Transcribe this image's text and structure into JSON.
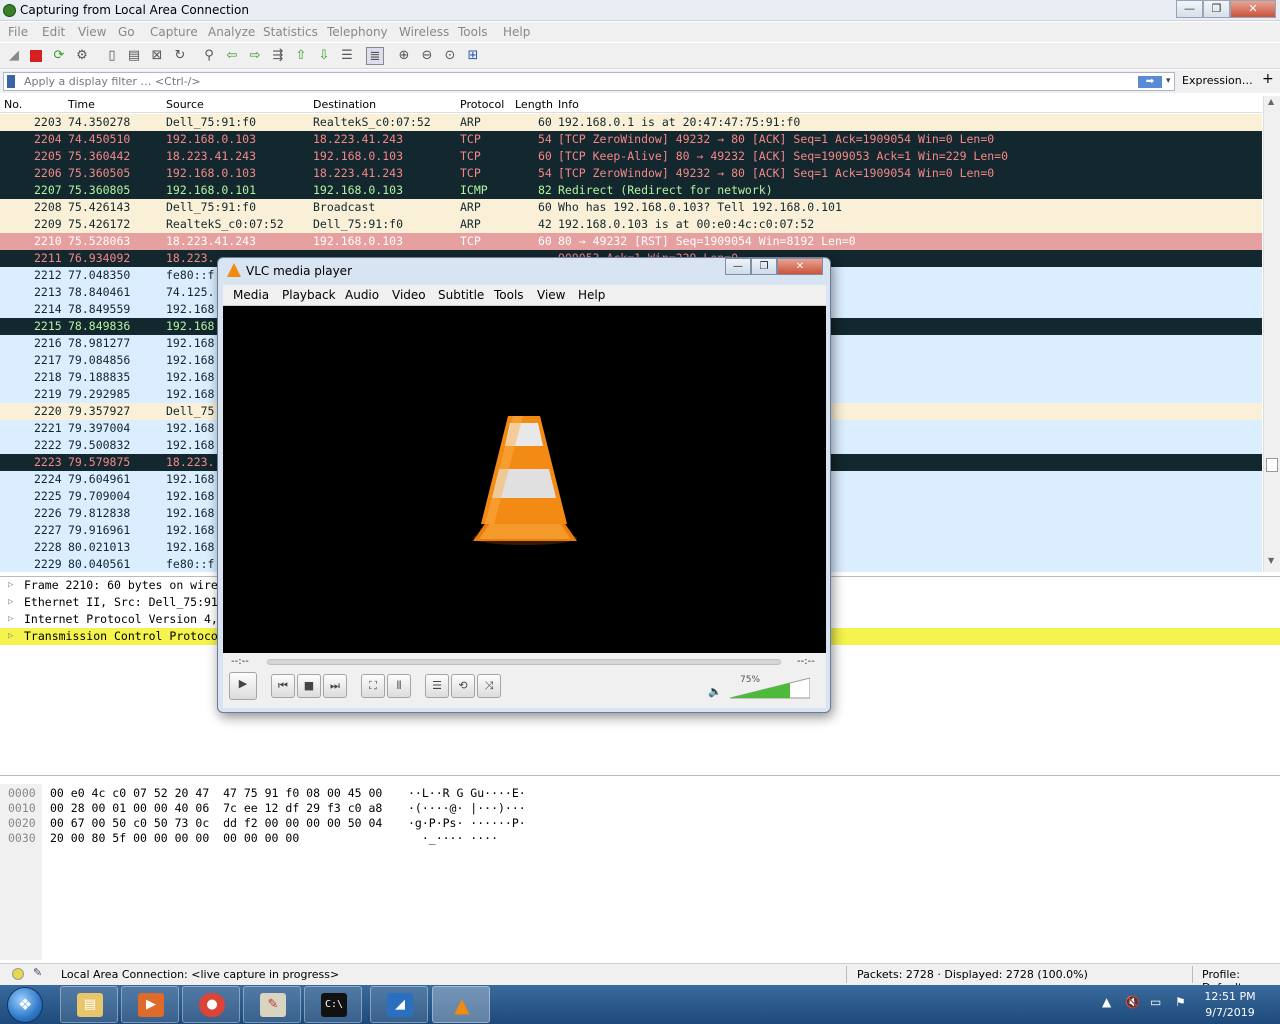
{
  "window": {
    "title": "Capturing from Local Area Connection",
    "min": "—",
    "max": "❐",
    "close": "✕"
  },
  "menu": [
    "File",
    "Edit",
    "View",
    "Go",
    "Capture",
    "Analyze",
    "Statistics",
    "Telephony",
    "Wireless",
    "Tools",
    "Help"
  ],
  "filter": {
    "placeholder": "Apply a display filter … <Ctrl-/>",
    "apply": "➡",
    "dropdown": "▾",
    "expression": "Expression…",
    "plus": "+"
  },
  "columns": {
    "no": "No.",
    "time": "Time",
    "source": "Source",
    "destination": "Destination",
    "protocol": "Protocol",
    "length": "Length",
    "info": "Info"
  },
  "packets": [
    {
      "no": "2203",
      "time": "74.350278",
      "src": "Dell_75:91:f0",
      "dst": "RealtekS_c0:07:52",
      "proto": "ARP",
      "len": "60",
      "info": "192.168.0.1 is at 20:47:47:75:91:f0",
      "style": "arp"
    },
    {
      "no": "2204",
      "time": "74.450510",
      "src": "192.168.0.103",
      "dst": "18.223.41.243",
      "proto": "TCP",
      "len": "54",
      "info": "[TCP ZeroWindow] 49232 → 80 [ACK] Seq=1 Ack=1909054 Win=0 Len=0",
      "style": "tcpbad"
    },
    {
      "no": "2205",
      "time": "75.360442",
      "src": "18.223.41.243",
      "dst": "192.168.0.103",
      "proto": "TCP",
      "len": "60",
      "info": "[TCP Keep-Alive] 80 → 49232 [ACK] Seq=1909053 Ack=1 Win=229 Len=0",
      "style": "tcpbad"
    },
    {
      "no": "2206",
      "time": "75.360505",
      "src": "192.168.0.103",
      "dst": "18.223.41.243",
      "proto": "TCP",
      "len": "54",
      "info": "[TCP ZeroWindow] 49232 → 80 [ACK] Seq=1 Ack=1909054 Win=0 Len=0",
      "style": "tcpbad"
    },
    {
      "no": "2207",
      "time": "75.360805",
      "src": "192.168.0.101",
      "dst": "192.168.0.103",
      "proto": "ICMP",
      "len": "82",
      "info": "Redirect             (Redirect for network)",
      "style": "icmpbad"
    },
    {
      "no": "2208",
      "time": "75.426143",
      "src": "Dell_75:91:f0",
      "dst": "Broadcast",
      "proto": "ARP",
      "len": "60",
      "info": "Who has 192.168.0.103? Tell 192.168.0.101",
      "style": "arp"
    },
    {
      "no": "2209",
      "time": "75.426172",
      "src": "RealtekS_c0:07:52",
      "dst": "Dell_75:91:f0",
      "proto": "ARP",
      "len": "42",
      "info": "192.168.0.103 is at 00:e0:4c:c0:07:52",
      "style": "arp"
    },
    {
      "no": "2210",
      "time": "75.528063",
      "src": "18.223.41.243",
      "dst": "192.168.0.103",
      "proto": "TCP",
      "len": "60",
      "info": "80 → 49232 [RST] Seq=1909054 Win=8192 Len=0",
      "style": "sel"
    },
    {
      "no": "2211",
      "time": "76.934092",
      "src": "18.223.",
      "dst": "",
      "proto": "",
      "len": "",
      "info": "909053 Ack=1 Win=229 Len=0",
      "style": "tcpbad"
    },
    {
      "no": "2212",
      "time": "77.048350",
      "src": "fe80::f",
      "dst": "",
      "proto": "",
      "len": "",
      "info": "",
      "style": "udp"
    },
    {
      "no": "2213",
      "time": "78.840461",
      "src": "74.125.",
      "dst": "",
      "proto": "",
      "len": "",
      "info": "",
      "style": "udp"
    },
    {
      "no": "2214",
      "time": "78.849559",
      "src": "192.168",
      "dst": "",
      "proto": "",
      "len": "",
      "info": "",
      "style": "udp"
    },
    {
      "no": "2215",
      "time": "78.849836",
      "src": "192.168",
      "dst": "",
      "proto": "",
      "len": "",
      "info": "ork)",
      "style": "icmpbad"
    },
    {
      "no": "2216",
      "time": "78.981277",
      "src": "192.168",
      "dst": "",
      "proto": "",
      "len": "",
      "info": "",
      "style": "udp"
    },
    {
      "no": "2217",
      "time": "79.084856",
      "src": "192.168",
      "dst": "",
      "proto": "",
      "len": "",
      "info": "",
      "style": "udp"
    },
    {
      "no": "2218",
      "time": "79.188835",
      "src": "192.168",
      "dst": "",
      "proto": "",
      "len": "",
      "info": "",
      "style": "udp"
    },
    {
      "no": "2219",
      "time": "79.292985",
      "src": "192.168",
      "dst": "",
      "proto": "",
      "len": "",
      "info": "",
      "style": "udp"
    },
    {
      "no": "2220",
      "time": "79.357927",
      "src": "Dell_75",
      "dst": "",
      "proto": "",
      "len": "",
      "info": "",
      "style": "arp"
    },
    {
      "no": "2221",
      "time": "79.397004",
      "src": "192.168",
      "dst": "",
      "proto": "",
      "len": "",
      "info": "",
      "style": "udp"
    },
    {
      "no": "2222",
      "time": "79.500832",
      "src": "192.168",
      "dst": "",
      "proto": "",
      "len": "",
      "info": "",
      "style": "udp"
    },
    {
      "no": "2223",
      "time": "79.579875",
      "src": "18.223.",
      "dst": "",
      "proto": "",
      "len": "",
      "info": "909053 Ack=1 Win=229 Len=0",
      "style": "tcpbad"
    },
    {
      "no": "2224",
      "time": "79.604961",
      "src": "192.168",
      "dst": "",
      "proto": "",
      "len": "",
      "info": "",
      "style": "udp"
    },
    {
      "no": "2225",
      "time": "79.709004",
      "src": "192.168",
      "dst": "",
      "proto": "",
      "len": "",
      "info": "",
      "style": "udp"
    },
    {
      "no": "2226",
      "time": "79.812838",
      "src": "192.168",
      "dst": "",
      "proto": "",
      "len": "",
      "info": "",
      "style": "udp"
    },
    {
      "no": "2227",
      "time": "79.916961",
      "src": "192.168",
      "dst": "",
      "proto": "",
      "len": "",
      "info": "",
      "style": "udp"
    },
    {
      "no": "2228",
      "time": "80.021013",
      "src": "192.168",
      "dst": "",
      "proto": "",
      "len": "",
      "info": "",
      "style": "udp"
    },
    {
      "no": "2229",
      "time": "80.040561",
      "src": "fe80::f",
      "dst": "",
      "proto": "",
      "len": "",
      "info": "",
      "style": "udp"
    }
  ],
  "details": [
    {
      "text": "Frame 2210: 60 bytes on wire",
      "hl": false
    },
    {
      "text": "Ethernet II, Src: Dell_75:91",
      "hl": false
    },
    {
      "text": "Internet Protocol Version 4,",
      "hl": false
    },
    {
      "text": "Transmission Control Protoco",
      "hl": true
    }
  ],
  "bytes": [
    {
      "off": "0000",
      "hex": "00 e0 4c c0 07 52 20 47  47 75 91 f0 08 00 45 00",
      "ascii": "··L··R G Gu····E·"
    },
    {
      "off": "0010",
      "hex": "00 28 00 01 00 00 40 06  7c ee 12 df 29 f3 c0 a8",
      "ascii": "·(····@· |···)···"
    },
    {
      "off": "0020",
      "hex": "00 67 00 50 c0 50 73 0c  dd f2 00 00 00 00 50 04",
      "ascii": "·g·P·Ps· ······P·"
    },
    {
      "off": "0030",
      "hex": "20 00 80 5f 00 00 00 00  00 00 00 00",
      "ascii": "  ·_···· ····"
    }
  ],
  "status": {
    "capture": "Local Area Connection: <live capture in progress>",
    "packets": "Packets: 2728 · Displayed: 2728 (100.0%)",
    "profile": "Profile: Default"
  },
  "vlc": {
    "title": "VLC media player",
    "menu": [
      "Media",
      "Playback",
      "Audio",
      "Video",
      "Subtitle",
      "Tools",
      "View",
      "Help"
    ],
    "time_left": "--:--",
    "time_right": "--:--",
    "volume_label": "75%",
    "volume": 0.75
  },
  "clock": {
    "time": "12:51 PM",
    "date": "9/7/2019"
  },
  "colors": {
    "accent": "#f08a10",
    "selected_row": "#e6a0a0",
    "bad_row": "#12272e",
    "highlight": "#f5f34e"
  }
}
